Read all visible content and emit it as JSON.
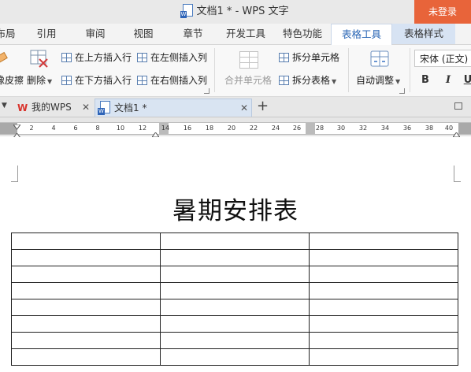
{
  "window": {
    "title": "文档1 * - WPS 文字",
    "login_label": "未登录"
  },
  "menu": {
    "tabs": [
      {
        "label": "布局",
        "state": "normal"
      },
      {
        "label": "引用",
        "state": "normal"
      },
      {
        "label": "审阅",
        "state": "normal"
      },
      {
        "label": "视图",
        "state": "normal"
      },
      {
        "label": "章节",
        "state": "normal"
      },
      {
        "label": "开发工具",
        "state": "normal"
      },
      {
        "label": "特色功能",
        "state": "normal"
      },
      {
        "label": "表格工具",
        "state": "active"
      },
      {
        "label": "表格样式",
        "state": "contextual"
      }
    ]
  },
  "ribbon": {
    "eraser_label": "橡皮擦",
    "delete_label": "删除",
    "insert_above": "在上方插入行",
    "insert_below": "在下方插入行",
    "insert_left": "在左侧插入列",
    "insert_right": "在右侧插入列",
    "merge_cells": "合并单元格",
    "split_cells": "拆分单元格",
    "split_table": "拆分表格",
    "auto_fit": "自动调整",
    "font_name": "宋体 (正文)",
    "bold": "B",
    "italic": "I",
    "underline": "U"
  },
  "doc_tabs": [
    {
      "label": "我的WPS",
      "active": false
    },
    {
      "label": "文档1 *",
      "active": true
    }
  ],
  "ruler": {
    "ticks": [
      "2",
      "4",
      "6",
      "8",
      "10",
      "12",
      "14",
      "16",
      "18",
      "20",
      "22",
      "24",
      "26",
      "28",
      "30",
      "32",
      "34",
      "36",
      "38",
      "40"
    ]
  },
  "document": {
    "heading": "暑期安排表",
    "table": {
      "rows": 8,
      "cols": 3
    }
  },
  "colors": {
    "accent": "#2a66b5",
    "login": "#e8643a",
    "wps_red": "#d9332c"
  }
}
